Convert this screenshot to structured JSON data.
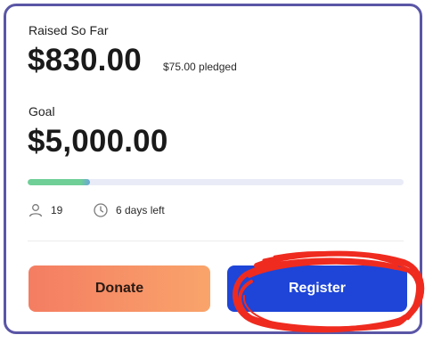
{
  "campaign": {
    "raised_label": "Raised So Far",
    "raised_amount": "$830.00",
    "pledged_text": "$75.00 pledged",
    "goal_label": "Goal",
    "goal_amount": "$5,000.00",
    "progress_fraction": 0.166,
    "donor_count": "19",
    "days_left": "6 days left"
  },
  "actions": {
    "donate_label": "Donate",
    "register_label": "Register"
  },
  "annotation": {
    "stroke_color": "#ef2b1f"
  },
  "icons": {
    "donors": "person-icon",
    "days": "clock-icon"
  },
  "colors": {
    "card_border": "#5a56a6",
    "progress_fill": "#6fcf97",
    "progress_track": "#e9ecf6",
    "donate_start": "#f47d62",
    "donate_end": "#f9a46b",
    "register_bg": "#1e45d7"
  }
}
